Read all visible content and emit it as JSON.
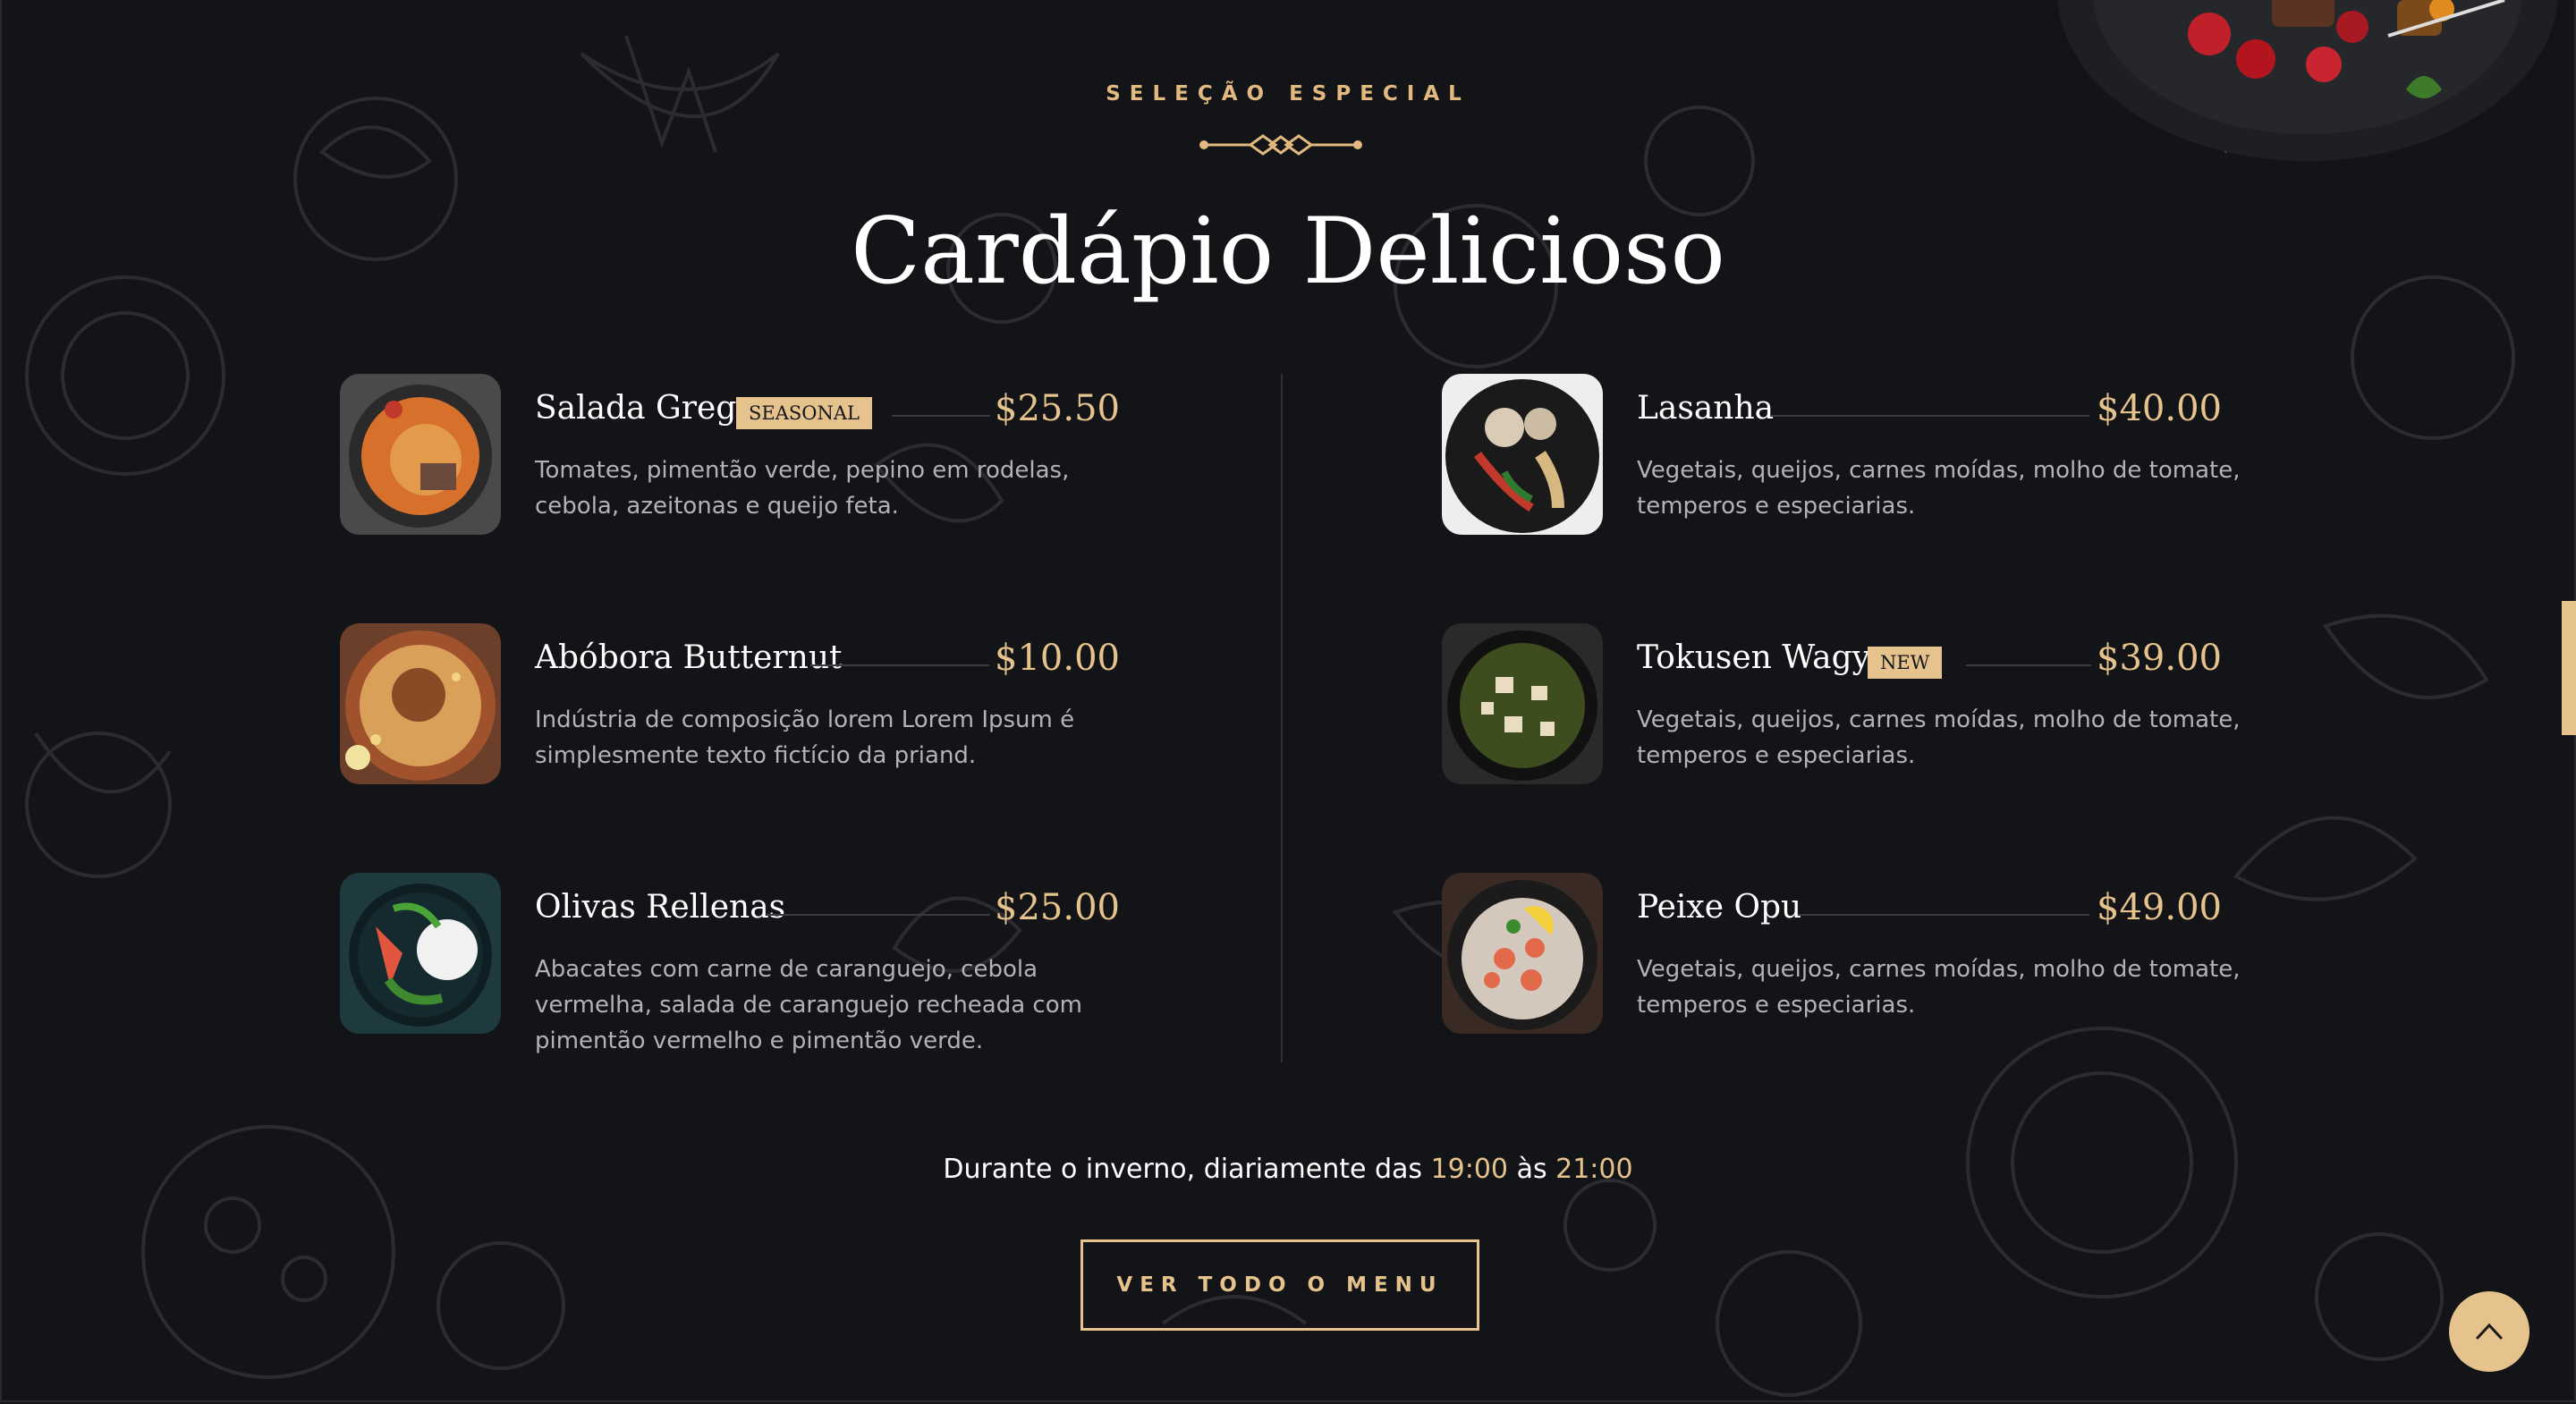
{
  "section": {
    "eyebrow": "SELEÇÃO ESPECIAL",
    "title": "Cardápio Delicioso"
  },
  "menu_items": [
    {
      "name": "Salada Grega",
      "badge": "SEASONAL",
      "price": "$25.50",
      "description": "Tomates, pimentão verde, pepino em rodelas, cebola, azeitonas e queijo feta."
    },
    {
      "name": "Abóbora Butternut",
      "badge": "",
      "price": "$10.00",
      "description": "Indústria de composição lorem Lorem Ipsum é simplesmente texto fictício da priand."
    },
    {
      "name": "Olivas Rellenas",
      "badge": "",
      "price": "$25.00",
      "description": "Abacates com carne de caranguejo, cebola vermelha, salada de caranguejo recheada com pimentão vermelho e pimentão verde."
    },
    {
      "name": "Lasanha",
      "badge": "",
      "price": "$40.00",
      "description": "Vegetais, queijos, carnes moídas, molho de tomate, temperos e especiarias."
    },
    {
      "name": "Tokusen Wagyu",
      "badge": "NEW",
      "price": "$39.00",
      "description": "Vegetais, queijos, carnes moídas, molho de tomate, temperos e especiarias."
    },
    {
      "name": "Peixe Opu",
      "badge": "",
      "price": "$49.00",
      "description": "Vegetais, queijos, carnes moídas, molho de tomate, temperos e especiarias."
    }
  ],
  "hours": {
    "prefix": "Durante o inverno, diariamente das ",
    "open": "19:00",
    "middle": " às ",
    "close": "21:00"
  },
  "cta": {
    "label": "VER TODO O MENU"
  },
  "icons": {
    "back_to_top": "chevron-up-icon"
  },
  "colors": {
    "background": "#131417",
    "accent": "#e6c28d",
    "text": "#ffffff",
    "muted": "#b2b3b6"
  }
}
